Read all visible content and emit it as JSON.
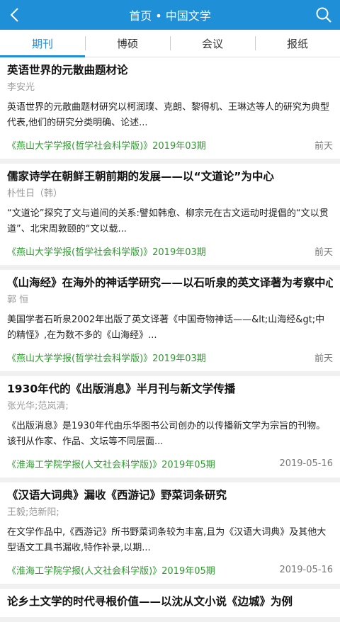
{
  "header": {
    "title": "首页 • 中国文学"
  },
  "tabs": [
    "期刊",
    "博硕",
    "会议",
    "报纸"
  ],
  "articles": [
    {
      "title": "英语世界的元散曲题材论",
      "author": "李安光",
      "summary": "英语世界的元散曲题材研究以柯润璞、克朗、黎得机、王琳达等人的研究为典型代表,他们的研究分类明确、论述...",
      "source": "《燕山大学学报(哲学社会科学版)》2019年03期",
      "date": "前天"
    },
    {
      "title": "儒家诗学在朝鲜王朝前期的发展——以“文道论”为中心",
      "author": "朴性日（韩）",
      "summary": "“文道论”探究了文与道间的关系:譬如韩愈、柳宗元在古文运动时提倡的“文以贯道”、北宋周敦颐的“文以载...",
      "source": "《燕山大学学报(哲学社会科学版)》2019年03期",
      "date": "前天"
    },
    {
      "title": "《山海经》在海外的神话学研究——以石听泉的英文译著为考察中心",
      "author": "郭 恒",
      "summary": "美国学者石听泉2002年出版了英文译著《中国奇物神话——&lt;山海经&gt;中的精怪》,在为数不多的《山海经》...",
      "source": "《燕山大学学报(哲学社会科学版)》2019年03期",
      "date": "前天"
    },
    {
      "title": "1930年代的《出版消息》半月刊与新文学传播",
      "author": "张光华;范岚清;",
      "summary": "《出版消息》是1930年代由乐华图书公司创办的以传播新文学为宗旨的刊物。该刊从作家、作品、文坛等不同层面...",
      "source": "《淮海工学院学报(人文社会科学版)》2019年05期",
      "date": "2019-05-16"
    },
    {
      "title": "《汉语大词典》漏收《西游记》野菜词条研究",
      "author": "王毅;范新阳;",
      "summary": "在文学作品中,《西游记》所书野菜词条较为丰富,且为《汉语大词典》及其他大型语文工具书漏收,特作补录,以期...",
      "source": "《淮海工学院学报(人文社会科学版)》2019年05期",
      "date": "2019-05-16"
    },
    {
      "title": "论乡土文学的时代寻根价值——以沈从文小说《边城》为例",
      "author": "",
      "summary": "",
      "source": "",
      "date": ""
    }
  ]
}
